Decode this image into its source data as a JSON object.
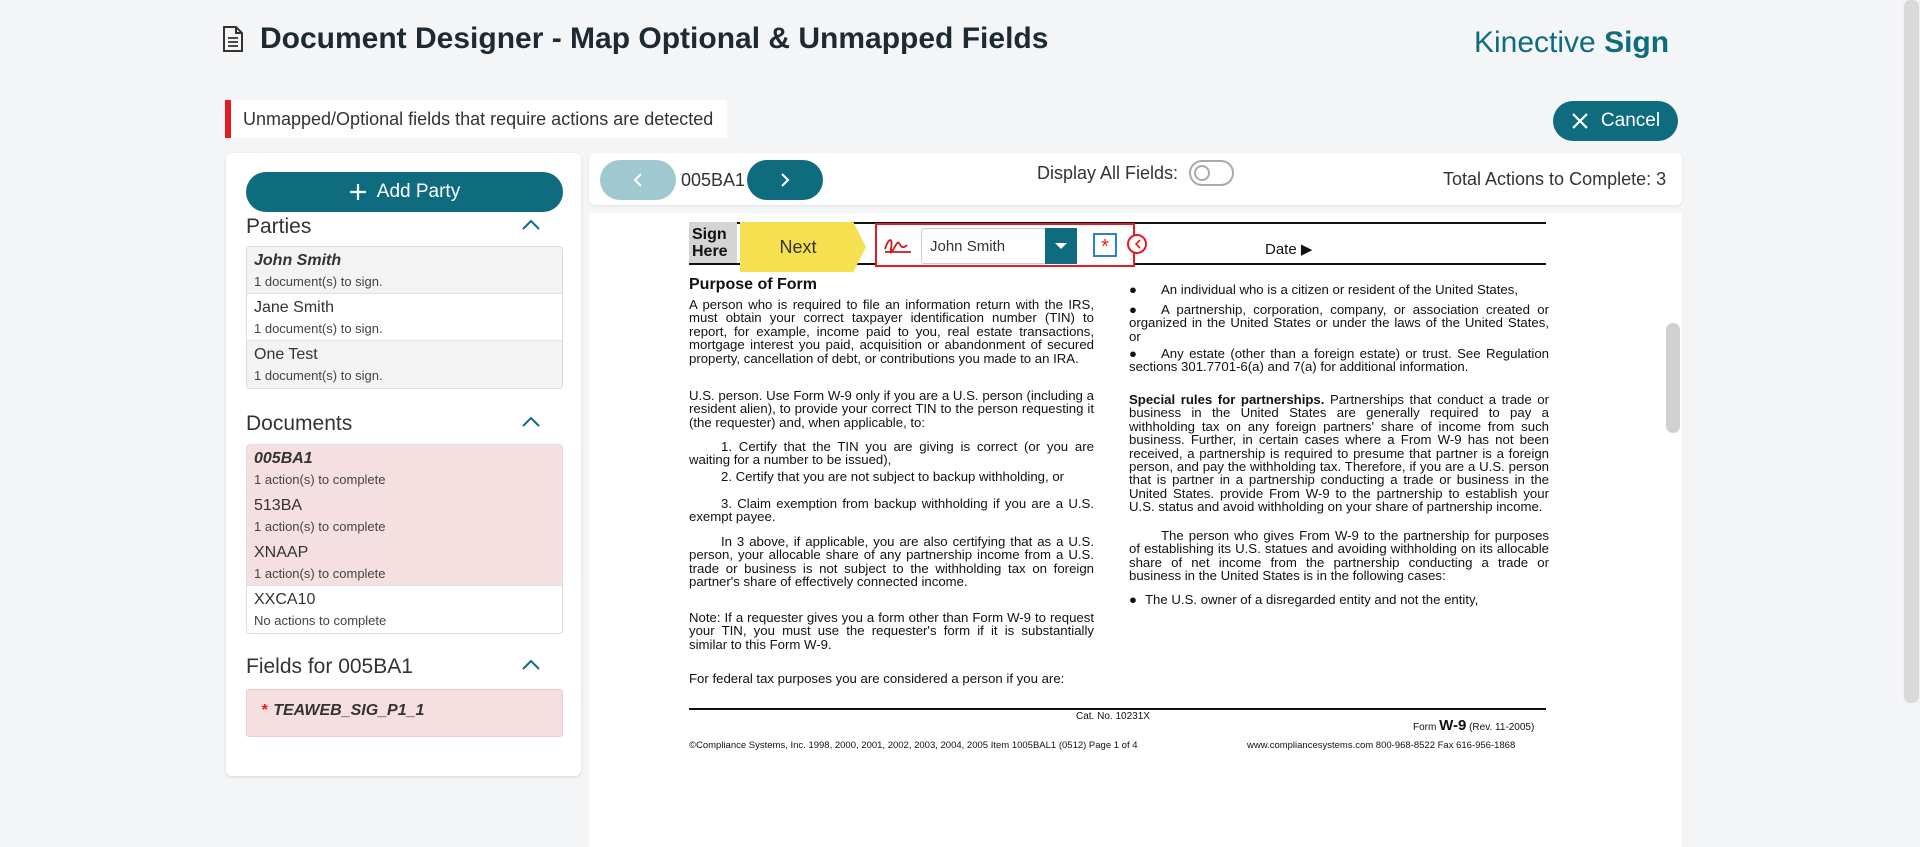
{
  "header": {
    "title": "Document Designer - Map Optional & Unmapped Fields",
    "brand_light": "Kinective ",
    "brand_bold": "Sign"
  },
  "alert": {
    "text": "Unmapped/Optional fields that require actions are detected"
  },
  "cancel_label": "Cancel",
  "add_party_label": "Add Party",
  "parties": {
    "title": "Parties",
    "items": [
      {
        "name": "John Smith",
        "sub": "1 document(s) to sign."
      },
      {
        "name": "Jane Smith",
        "sub": "1 document(s) to sign."
      },
      {
        "name": "One Test",
        "sub": "1 document(s) to sign."
      }
    ]
  },
  "documents": {
    "title": "Documents",
    "items": [
      {
        "name": "005BA1",
        "sub": "1 action(s) to complete"
      },
      {
        "name": "513BA",
        "sub": "1 action(s) to complete"
      },
      {
        "name": "XNAAP",
        "sub": "1 action(s) to complete"
      },
      {
        "name": "XXCA10",
        "sub": "No actions to complete"
      }
    ]
  },
  "fields": {
    "title": "Fields for 005BA1",
    "items": [
      {
        "required": "*",
        "name": "TEAWEB_SIG_P1_1"
      }
    ]
  },
  "toolbar": {
    "doc_name": "005BA1",
    "display_all_label": "Display All Fields:",
    "total_label": "Total Actions to Complete:",
    "total_value": "3"
  },
  "sigfield": {
    "next_label": "Next",
    "signer": "John Smith",
    "required_mark": "*"
  },
  "pdf": {
    "sign_here": [
      "Sign",
      "Here"
    ],
    "date_label": "Date",
    "purpose_title": "Purpose of Form",
    "left_p1": "A person who is required to file an information return with the IRS, must obtain your correct taxpayer identification number (TIN) to report, for example, income paid to you, real estate transactions, mortgage interest you paid, acquisition or abandonment of secured property, cancellation of debt, or contributions you made to an IRA.",
    "left_p2": "U.S. person. Use Form W-9 only if you are a U.S. person (including a resident alien), to provide your correct TIN to the person requesting it (the requester) and, when applicable, to:",
    "left_l1": "1. Certify that the TIN you are giving is correct (or you are waiting for a number to be issued),",
    "left_l2": "2. Certify that you are not subject to backup withholding, or",
    "left_l3": "3. Claim exemption from backup withholding if you are a U.S. exempt payee.",
    "left_p3": "In 3 above, if applicable, you are also certifying that as a U.S. person, your allocable share of any partnership income from a U.S. trade or business is not subject to the withholding tax on foreign partner's share of effectively connected income.",
    "left_p4": "Note: If a requester gives you a form other than Form W-9 to request your TIN, you must use the requester's form if it is substantially similar to this Form W-9.",
    "left_p5": "For federal tax purposes you are considered a person if you are:",
    "right_b1": "An individual who is a citizen or resident of the United States,",
    "right_b2": "A partnership, corporation, company, or association created or organized in the United States or under the laws of the United States, or",
    "right_b3": "Any estate (other than a foreign estate) or trust. See Regulation sections 301.7701-6(a) and 7(a) for additional information.",
    "right_sp_bold": "Special rules for partnerships.",
    "right_sp": " Partnerships that conduct a trade or business in the United States are generally required to pay a withholding tax on any foreign partners' share of income from such business. Further, in certain cases where a From W-9 has not been received, a partnership is required to presume that partner is a foreign person, and pay the withholding tax. Therefore, if you are a U.S. person that is partner in a partnership conducting a trade or business in the United States. provide From W-9 to the partnership to establish your U.S. status and avoid withholding on your share of partnership income.",
    "right_p2": "The person who gives From W-9 to the partnership for purposes of establishing its U.S. statues and avoiding withholding on its allocable share of net income from the partnership conducting a trade or business in the United States is in the following cases:",
    "right_b4": "The U.S. owner of a disregarded entity and not the entity,",
    "cat_no": "Cat. No. 10231X",
    "form_prefix": "Form ",
    "form_name": "W-9",
    "form_rev": " (Rev. 11-2005)",
    "footer_left": "©Compliance Systems, Inc.  1998, 2000, 2001, 2002, 2003, 2004, 2005  Item 1005BAL1 (0512)   Page 1 of 4",
    "footer_right": "www.compliancesystems.com 800-968-8522 Fax 616-956-1868"
  },
  "colors": {
    "accent": "#0f6b7e",
    "alert": "#e51b23",
    "selected_bg": "#f5dfe1",
    "next_yellow": "#f5e04f"
  }
}
